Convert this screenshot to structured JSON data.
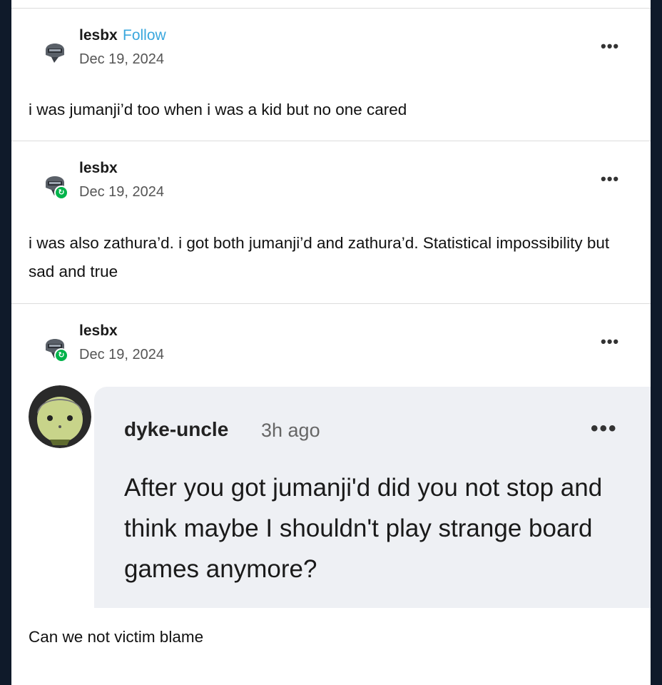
{
  "posts": [
    {
      "username": "lesbx",
      "follow_label": "Follow",
      "date": "Dec 19, 2024",
      "more": "•••",
      "text": "i was jumanji’d too when i was a kid but no one cared"
    },
    {
      "username": "lesbx",
      "date": "Dec 19, 2024",
      "more": "•••",
      "text": "i was also zathura’d. i got both jumanji’d and zathura’d. Statistical impossibility but sad and true"
    },
    {
      "username": "lesbx",
      "date": "Dec 19, 2024",
      "more": "•••"
    }
  ],
  "quoted": {
    "username": "dyke-uncle",
    "time": "3h ago",
    "more": "•••",
    "text": "After you got jumanji'd did you not stop and think maybe I shouldn't play strange board games anymore?"
  },
  "reply_text": "Can we not victim blame",
  "icons": {
    "avatar": "helmet-avatar-icon",
    "reblog": "reblog-badge-icon",
    "more": "more-options-icon"
  },
  "colors": {
    "follow": "#3aa7dd",
    "reblog_badge": "#00b34a",
    "quote_background": "#eef0f4"
  }
}
